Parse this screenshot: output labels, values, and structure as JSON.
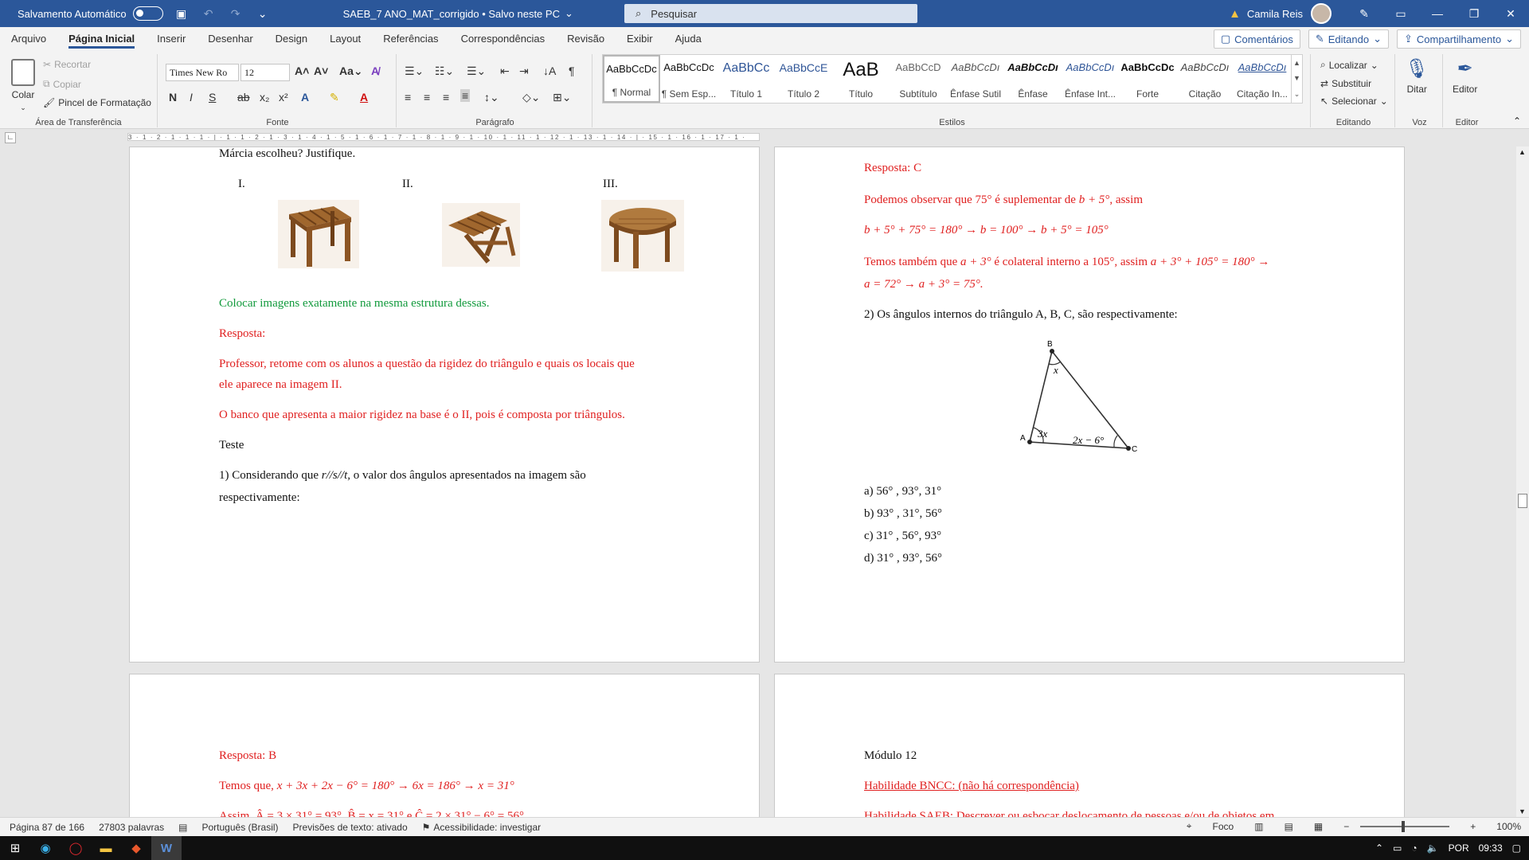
{
  "titlebar": {
    "autosave": "Salvamento Automático",
    "doc_title": "SAEB_7 ANO_MAT_corrigido • Salvo neste PC",
    "search_placeholder": "Pesquisar",
    "user": "Camila Reis"
  },
  "tabs": [
    "Arquivo",
    "Página Inicial",
    "Inserir",
    "Desenhar",
    "Design",
    "Layout",
    "Referências",
    "Correspondências",
    "Revisão",
    "Exibir",
    "Ajuda"
  ],
  "tab_actions": {
    "comments": "Comentários",
    "editing": "Editando",
    "share": "Compartilhamento"
  },
  "ribbon": {
    "clipboard": {
      "paste": "Colar",
      "cut": "Recortar",
      "copy": "Copiar",
      "format_painter": "Pincel de Formatação",
      "label": "Área de Transferência"
    },
    "font": {
      "name": "Times New Ro",
      "size": "12",
      "label": "Fonte"
    },
    "paragraph": {
      "label": "Parágrafo"
    },
    "styles": {
      "label": "Estilos",
      "items": [
        {
          "sample": "AaBbCcDc",
          "name": "¶ Normal"
        },
        {
          "sample": "AaBbCcDc",
          "name": "¶ Sem Esp..."
        },
        {
          "sample": "AaBbCc",
          "name": "Título 1"
        },
        {
          "sample": "AaBbCcE",
          "name": "Título 2"
        },
        {
          "sample": "AaB",
          "name": "Título"
        },
        {
          "sample": "AaBbCcD",
          "name": "Subtítulo"
        },
        {
          "sample": "AaBbCcDı",
          "name": "Ênfase Sutil"
        },
        {
          "sample": "AaBbCcDı",
          "name": "Ênfase"
        },
        {
          "sample": "AaBbCcDı",
          "name": "Ênfase Int..."
        },
        {
          "sample": "AaBbCcDc",
          "name": "Forte"
        },
        {
          "sample": "AaBbCcDı",
          "name": "Citação"
        },
        {
          "sample": "AaBbCcDı",
          "name": "Citação In..."
        }
      ]
    },
    "editing": {
      "find": "Localizar",
      "replace": "Substituir",
      "select": "Selecionar",
      "label": "Editando"
    },
    "voice": {
      "dictate": "Ditar",
      "label": "Voz"
    },
    "editor": {
      "name": "Editor",
      "label": "Editor"
    }
  },
  "ruler_text": "3 · 1 · 2 · 1 · 1 · 1 · | · 1 · 1 · 2 · 1 · 3 · 1 · 4 · 1 · 5 · 1 · 6 · 1 · 7 · 1 · 8 · 1 · 9 · 1 · 10 · 1 · 11 · 1 · 12 · 1 · 13 · 1 · 14 · | · 15 · 1 · 16 · 1 · 17 · 1 ·",
  "page1": {
    "top_line": "Márcia escolheu? Justifique.",
    "labels": [
      "I.",
      "II.",
      "III."
    ],
    "green_note": "Colocar imagens exatamente na mesma estrutura dessas.",
    "answer_label": "Resposta:",
    "answer_l1": "Professor, retome com os alunos a questão da rigidez do triângulo e quais os locais que",
    "answer_l2": "ele aparece na imagem II.",
    "answer_l3": "O banco que apresenta a maior rigidez na base é o II, pois é composta por triângulos.",
    "teste": "Teste",
    "q1_l1a": "1)  Considerando  que ",
    "q1_math": "r//s//t,",
    "q1_l1b": " o  valor  dos  ângulos  apresentados  na  imagem  são",
    "q1_l2": "respectivamente:"
  },
  "page2": {
    "answer": "Resposta: C",
    "l1a": "Podemos observar que 75° é suplementar de ",
    "l1m": "b + 5°",
    "l1b": ", assim",
    "l2": "b + 5° + 75° = 180° → b = 100° → b + 5° = 105°",
    "l3a": "Temos também que ",
    "l3m": "a + 3°",
    "l3b": " é colateral interno a 105°, assim ",
    "l3c": "a + 3° + 105° = 180° →",
    "l4": "a = 72° → a + 3° = 75°.",
    "q2": "2) Os ângulos internos do triângulo A, B, C, são respectivamente:",
    "tri": {
      "A": "A",
      "B": "B",
      "C": "C",
      "angA": "3x",
      "angB": "x",
      "angC": "2x − 6°"
    },
    "options": [
      "a)  56° , 93°, 31°",
      "b)  93° , 31°, 56°",
      "c)  31° , 56°, 93°",
      "d)  31° , 93°, 56°"
    ]
  },
  "page3": {
    "answer": "Resposta: B",
    "l1a": "Temos que, ",
    "l1m": "x + 3x + 2x − 6° = 180° → 6x = 186° → x = 31°",
    "l2": "Assim, Â = 3 × 31° = 93°, B̂ = x = 31° e Ĉ = 2 × 31° − 6° = 56°"
  },
  "page4": {
    "module": "Módulo 12",
    "bncc": "Habilidade BNCC: (não há correspondência)",
    "saeb": "Habilidade SAEB: Descrever ou esboçar deslocamento de pessoas e/ou de objetos em"
  },
  "statusbar": {
    "page": "Página 87 de 166",
    "words": "27803 palavras",
    "language": "Português (Brasil)",
    "predictions": "Previsões de texto: ativado",
    "accessibility": "Acessibilidade: investigar",
    "focus": "Foco",
    "zoom": "100%"
  },
  "taskbar": {
    "lang": "POR",
    "time": "09:33"
  },
  "colors": {
    "word_blue": "#2b579a",
    "answer_red": "#e02020",
    "note_green": "#119a3c"
  }
}
